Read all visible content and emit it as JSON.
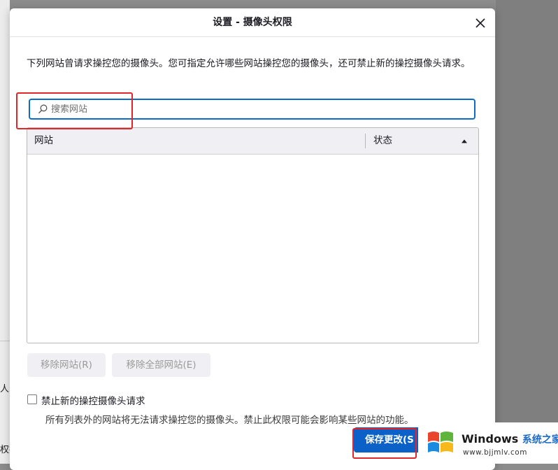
{
  "backdrop": {
    "fragment_1": "人",
    "fragment_2": "权据"
  },
  "dialog": {
    "title": "设置 - 摄像头权限",
    "description": "下列网站曾请求操控您的摄像头。您可指定允许哪些网站操控您的摄像头，还可禁止新的操控摄像头请求。",
    "search": {
      "placeholder": "搜索网站",
      "value": ""
    },
    "table": {
      "columns": [
        "网站",
        "状态"
      ],
      "sort_column": "状态",
      "sort_direction": "ascending",
      "rows": []
    },
    "buttons": {
      "remove_site": "移除网站(R)",
      "remove_all_sites": "移除全部网站(E)",
      "save": "保存更改(S"
    },
    "block_new_requests": {
      "label": "禁止新的操控摄像头请求",
      "checked": false,
      "hint": "所有列表外的网站将无法请求操控您的摄像头。禁止此权限可能会影响某些网站的功能。"
    },
    "icons": {
      "close": "close-icon",
      "search": "search-icon",
      "sort": "sort-ascending-icon"
    }
  },
  "watermark": {
    "brand": "Windows",
    "brand_cn": "系统之家",
    "url": "www.bjjmlv.com"
  },
  "colors": {
    "accent": "#0b61c8",
    "annotation": "#e0262b",
    "disabled_bg": "#f0f0f4"
  }
}
